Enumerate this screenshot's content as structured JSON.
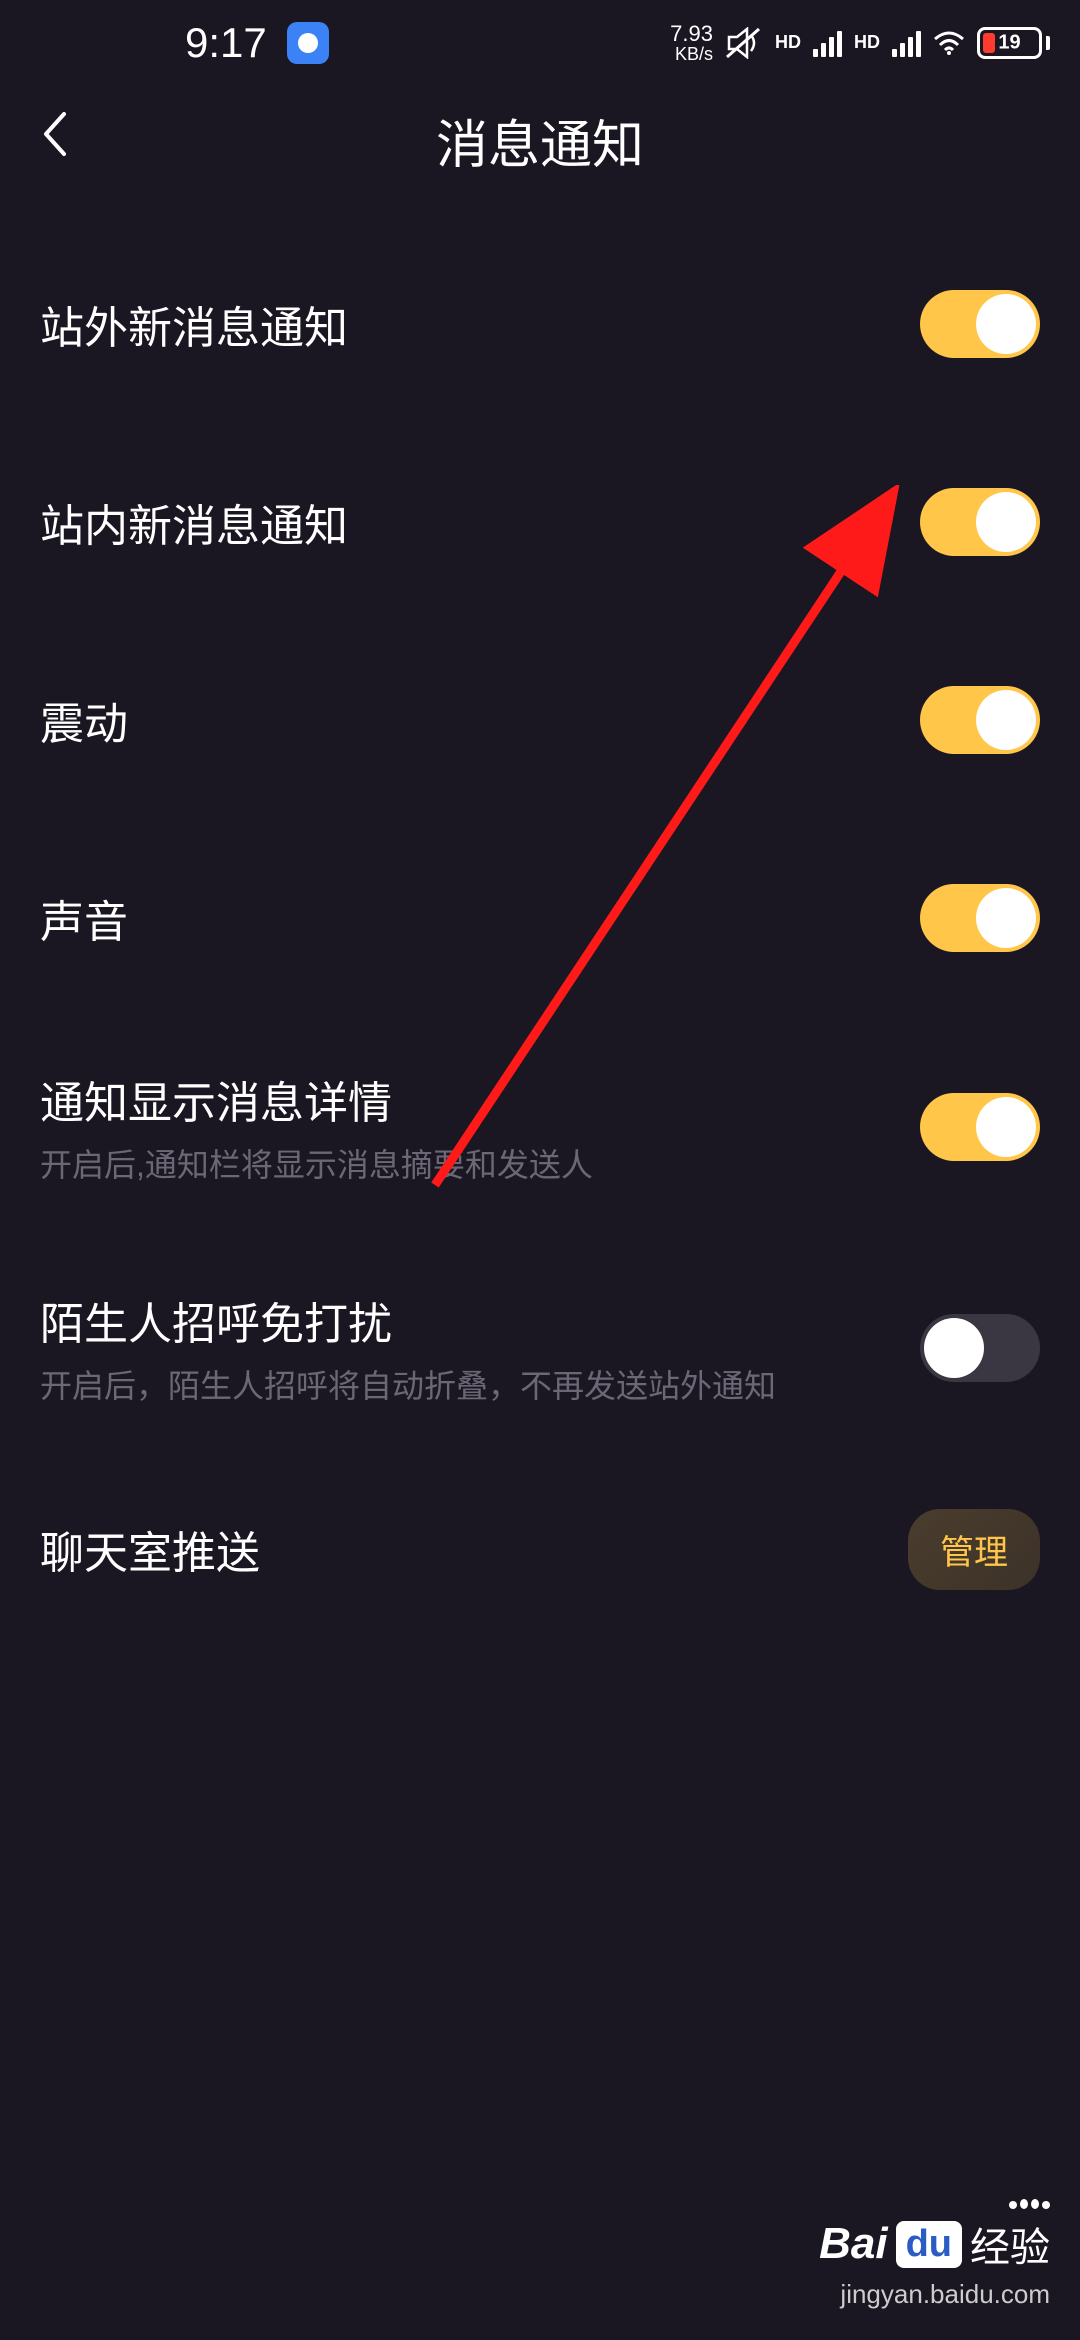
{
  "status_bar": {
    "time": "9:17",
    "net_speed": "7.93",
    "net_speed_unit": "KB/s",
    "hd_label": "HD",
    "battery_percent": "19"
  },
  "header": {
    "title": "消息通知"
  },
  "settings": {
    "external_notify": {
      "label": "站外新消息通知",
      "on": true
    },
    "internal_notify": {
      "label": "站内新消息通知",
      "on": true
    },
    "vibrate": {
      "label": "震动",
      "on": true
    },
    "sound": {
      "label": "声音",
      "on": true
    },
    "show_detail": {
      "label": "通知显示消息详情",
      "desc": "开启后,通知栏将显示消息摘要和发送人",
      "on": true
    },
    "stranger_dnd": {
      "label": "陌生人招呼免打扰",
      "desc": "开启后，陌生人招呼将自动折叠，不再发送站外通知",
      "on": false
    },
    "chatroom_push": {
      "label": "聊天室推送",
      "action": "管理"
    }
  },
  "watermark": {
    "brand_prefix": "Bai",
    "brand_mid": "du",
    "brand_suffix": "经验",
    "url": "jingyan.baidu.com"
  }
}
